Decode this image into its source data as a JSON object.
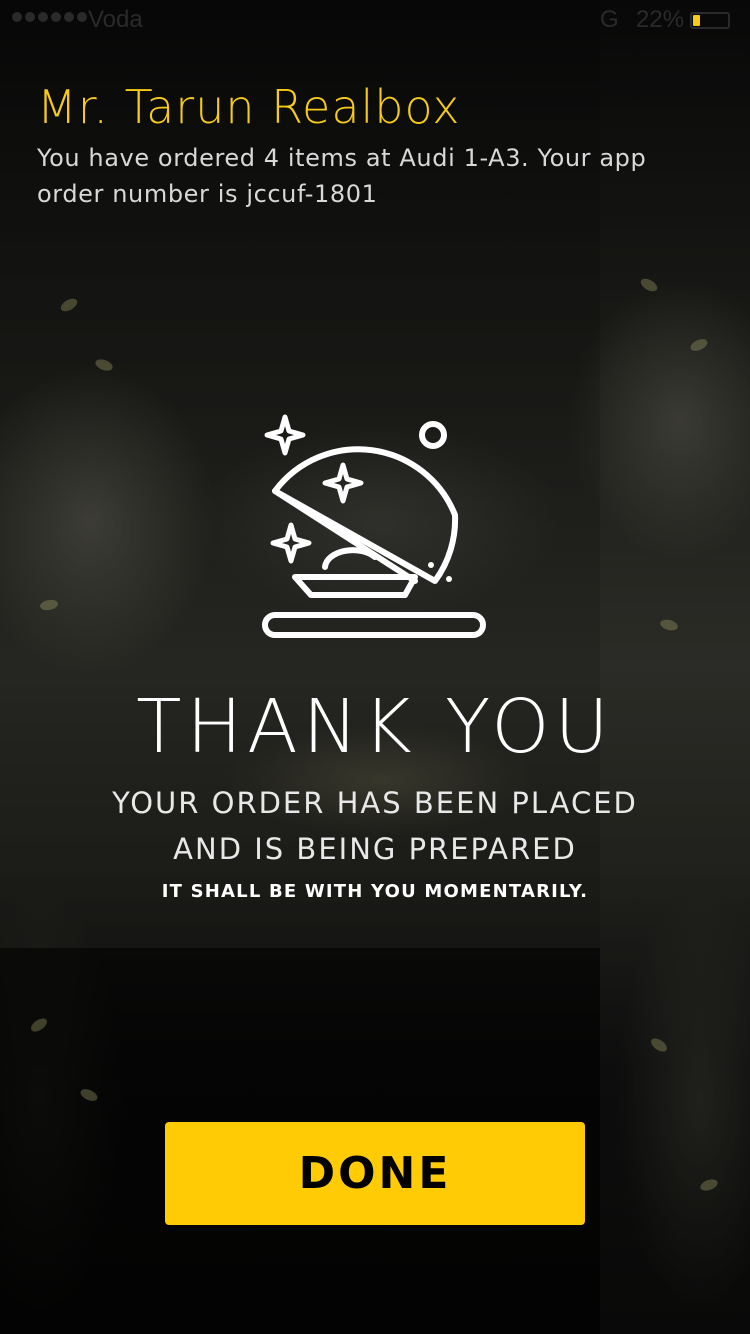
{
  "status_bar": {
    "carrier": "Voda",
    "network": "G",
    "battery_percent": "22%",
    "battery_level": 0.22,
    "signal_dots": 6
  },
  "order": {
    "customer_name": "Mr. Tarun Realbox",
    "message": "You have ordered 4 items at Audi 1-A3. Your app order number is jccuf-1801"
  },
  "confirmation": {
    "icon": "cloche-icon",
    "heading": "THANK YOU",
    "line1": "YOUR ORDER HAS BEEN PLACED",
    "line2": "AND IS BEING PREPARED",
    "note": "IT SHALL BE WITH YOU MOMENTARILY."
  },
  "actions": {
    "done_label": "DONE"
  },
  "colors": {
    "accent": "#ffcb05",
    "name": "#f7cb18",
    "text": "#ffffff",
    "background": "#000000"
  }
}
